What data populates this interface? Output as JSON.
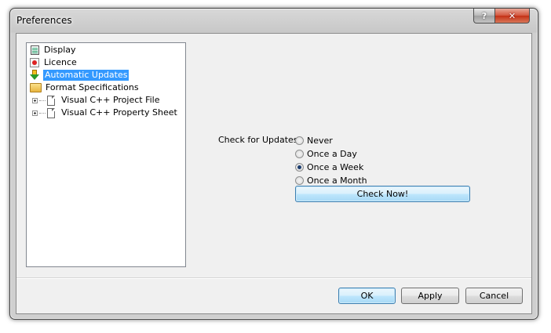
{
  "window": {
    "title": "Preferences",
    "help_button": "?",
    "close_button": "✕"
  },
  "tree": {
    "items": [
      {
        "label": "Display",
        "icon": "display-icon"
      },
      {
        "label": "Licence",
        "icon": "licence-icon"
      },
      {
        "label": "Automatic Updates",
        "icon": "update-icon",
        "selected": true
      },
      {
        "label": "Format Specifications",
        "icon": "folder-icon"
      },
      {
        "label": "Visual C++ Project File",
        "icon": "file-icon",
        "expandable": true
      },
      {
        "label": "Visual C++ Property Sheet",
        "icon": "file-icon",
        "expandable": true
      }
    ]
  },
  "updates": {
    "label": "Check for Updates",
    "options": [
      {
        "label": "Never",
        "checked": false
      },
      {
        "label": "Once a Day",
        "checked": false
      },
      {
        "label": "Once a Week",
        "checked": true
      },
      {
        "label": "Once a Month",
        "checked": false
      }
    ],
    "check_now": "Check Now!"
  },
  "footer": {
    "ok": "OK",
    "apply": "Apply",
    "cancel": "Cancel"
  },
  "colors": {
    "selection": "#3399ff",
    "close_button": "#c43015",
    "primary_button_border": "#3c7fb1"
  }
}
